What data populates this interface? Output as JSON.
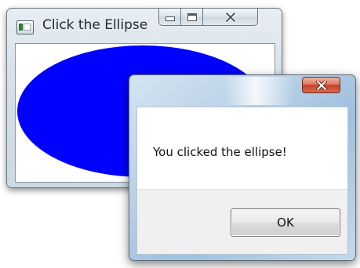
{
  "main_window": {
    "title": "Click the Ellipse",
    "caption_buttons": [
      "minimize",
      "maximize",
      "close"
    ],
    "ellipse_color": "#0000ff"
  },
  "dialog": {
    "message": "You clicked the ellipse!",
    "ok_label": "OK",
    "close_button_color": "#c8412a"
  }
}
